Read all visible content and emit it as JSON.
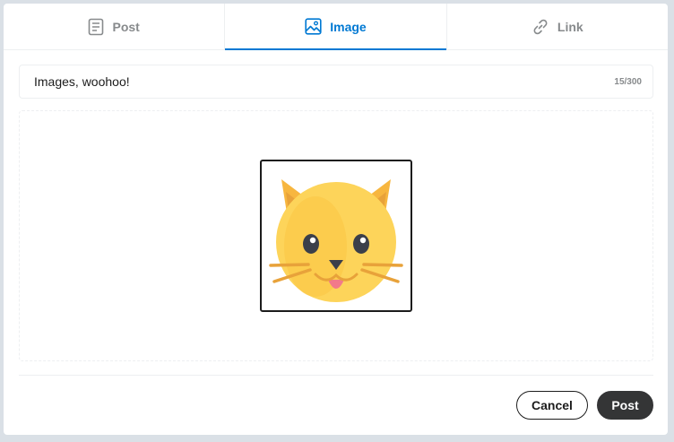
{
  "tabs": [
    {
      "label": "Post",
      "icon": "post-icon",
      "active": false
    },
    {
      "label": "Image",
      "icon": "image-icon",
      "active": true
    },
    {
      "label": "Link",
      "icon": "link-icon",
      "active": false
    }
  ],
  "title": {
    "value": "Images, woohoo!",
    "char_count": "15/300"
  },
  "preview": {
    "icon": "cat-face-icon"
  },
  "actions": {
    "cancel_label": "Cancel",
    "post_label": "Post"
  },
  "colors": {
    "accent": "#0079d3",
    "tab_inactive": "#878a8c",
    "post_button": "#343536",
    "background": "#dae0e6"
  }
}
